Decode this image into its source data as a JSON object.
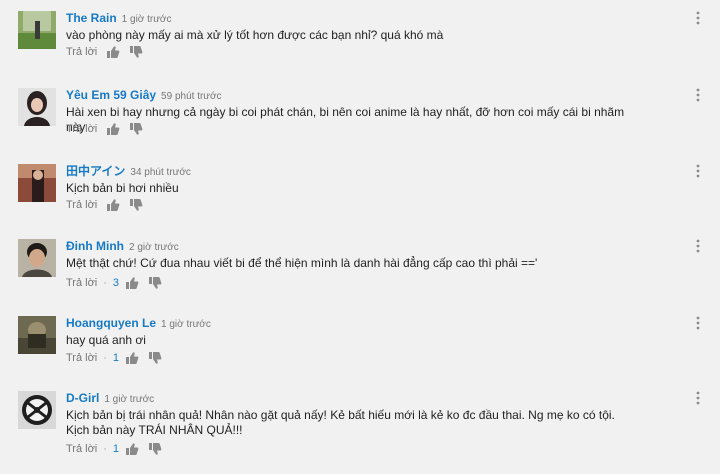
{
  "comments": [
    {
      "author": "The Rain",
      "time": "1 giờ trước",
      "text": "vào phòng này mấy ai mà xử lý tốt hơn được các bạn nhỉ? quá khó mà",
      "reply_label": "Trả lời",
      "likes": ""
    },
    {
      "author": "Yêu Em 59 Giây",
      "time": "59 phút trước",
      "text": "Hài xen bi hay nhưng cả ngày bi coi phát chán, bi nên coi anime là hay nhất, đỡ hơn coi mấy cái bi nhãm này",
      "reply_label": "Trả lời",
      "likes": ""
    },
    {
      "author": "田中アイン",
      "time": "34 phút trước",
      "text": "Kịch bản bi hơi nhiều",
      "reply_label": "Trả lời",
      "likes": ""
    },
    {
      "author": "Đinh Minh",
      "time": "2 giờ trước",
      "text": "Mệt thật chứ! Cứ đua nhau viết bi để thể hiện mình là danh hài đẳng cấp cao thì phải =='",
      "reply_label": "Trả lời",
      "dot": "·",
      "likes": "3"
    },
    {
      "author": "Hoangquyen Le",
      "time": "1 giờ trước",
      "text": "hay quá anh ơi",
      "reply_label": "Trả lời",
      "dot": "·",
      "likes": "1"
    },
    {
      "author": "D-Girl",
      "time": "1 giờ trước",
      "text": "Kịch bản bị trái nhân quả! Nhân nào gặt quả nấy! Kẻ bất hiếu mới là kẻ ko đc đầu thai. Ng mẹ ko có tội. Kịch bản này TRÁI NHÂN QUẢ!!!",
      "reply_label": "Trả lời",
      "dot": "·",
      "likes": "1"
    }
  ],
  "icons": {
    "like": "thumb-up-icon",
    "dislike": "thumb-down-icon",
    "menu": "more-vert-icon"
  },
  "colors": {
    "author": "#167ac6",
    "background": "#f1f1f1",
    "meta": "#767676"
  }
}
